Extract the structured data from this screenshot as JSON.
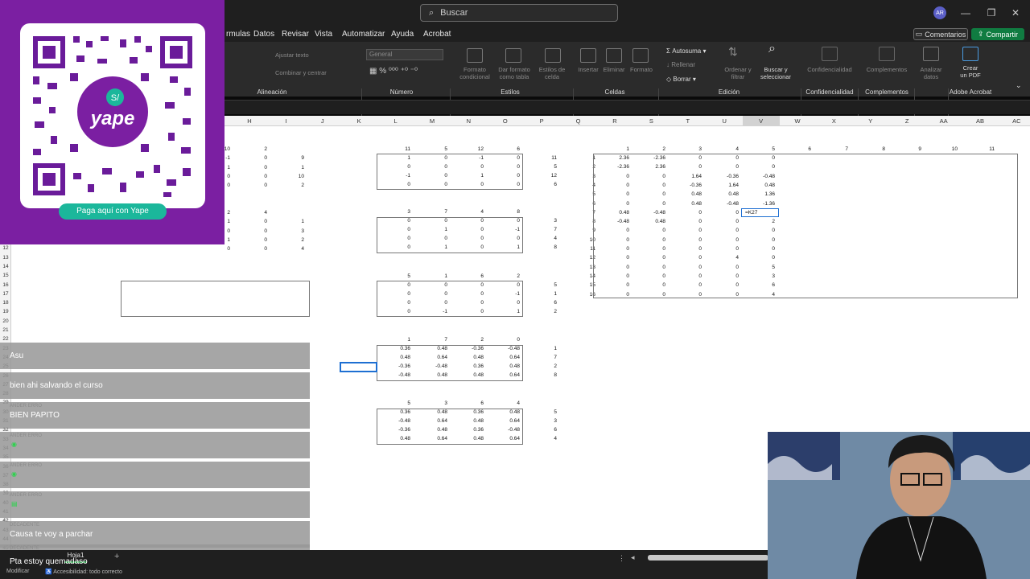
{
  "titlebar": {
    "search_placeholder": "Buscar",
    "avatar_initials": "AR",
    "minimize": "—",
    "maximize": "❐",
    "close": "✕"
  },
  "menu": [
    "rmulas",
    "Datos",
    "Revisar",
    "Vista",
    "Automatizar",
    "Ayuda",
    "Acrobat"
  ],
  "buttons": {
    "comments": "Comentarios",
    "share": "Compartir"
  },
  "ribbon": {
    "ajustar_texto": "Ajustar texto",
    "combinar": "Combinar y centrar",
    "number_format": "General",
    "formato_cond": "Formato\ncondicional",
    "dar_formato": "Dar formato\ncomo tabla",
    "estilos_celda": "Estilos de\ncelda",
    "insertar": "Insertar",
    "eliminar": "Eliminar",
    "formato": "Formato",
    "autosuma": "Autosuma",
    "rellenar": "Rellenar",
    "borrar": "Borrar",
    "ordenar": "Ordenar y\nfiltrar",
    "buscar_sel": "Buscar y\nseleccionar",
    "confidencialidad": "Confidencialidad",
    "complementos": "Complementos",
    "analizar": "Analizar\ndatos",
    "crear_pdf": "Crear\nun PDF",
    "groups": {
      "alineacion": "Alineación",
      "numero": "Número",
      "estilos": "Estilos",
      "celdas": "Celdas",
      "edicion": "Edición",
      "confidencialidad": "Confidencialidad",
      "complementos": "Complementos",
      "acrobat": "Adobe Acrobat"
    }
  },
  "columns": [
    "H",
    "I",
    "J",
    "K",
    "L",
    "M",
    "N",
    "O",
    "P",
    "Q",
    "R",
    "S",
    "T",
    "U",
    "V",
    "W",
    "X",
    "Y",
    "Z",
    "AA",
    "AB",
    "AC"
  ],
  "selected_column": "V",
  "formula_text": "=K27",
  "sheet_tab": "Hoja1",
  "status": {
    "mode": "Modificar",
    "accessibility": "Accesibilidad: todo correcto"
  },
  "qr": {
    "button_text": "Paga aquí con Yape",
    "brand": "yape"
  },
  "chat": [
    {
      "name": "",
      "message": "Asu"
    },
    {
      "name": "",
      "message": "bien ahi salvando el curso"
    },
    {
      "name": "ANDER ERRO",
      "message": "BIEN PAPITO"
    },
    {
      "name": "ANDER ERRO",
      "message": "",
      "emote": "◉"
    },
    {
      "name": "ANDER ERRO",
      "message": "",
      "emote": "◉"
    },
    {
      "name": "ANDER ERRO",
      "message": "",
      "emote": "▤"
    },
    {
      "name": "DECADENTE",
      "message": "Causa te voy a parchar"
    },
    {
      "name": "DECADENTE",
      "message": "Pta estoy quemadaso"
    }
  ],
  "cells": {
    "block1_header": [
      "11",
      "5",
      "12",
      "6"
    ],
    "block1": [
      [
        "1",
        "0",
        "-1",
        "0"
      ],
      [
        "0",
        "0",
        "0",
        "0"
      ],
      [
        "-1",
        "0",
        "1",
        "0"
      ],
      [
        "0",
        "0",
        "0",
        "0"
      ]
    ],
    "block1_side": [
      "11",
      "5",
      "12",
      "6"
    ],
    "block2_header": [
      "3",
      "7",
      "4",
      "8"
    ],
    "block2": [
      [
        "0",
        "0",
        "0",
        "0"
      ],
      [
        "0",
        "1",
        "0",
        "-1"
      ],
      [
        "0",
        "0",
        "0",
        "0"
      ],
      [
        "0",
        "1",
        "0",
        "1"
      ]
    ],
    "block2_side": [
      "3",
      "7",
      "4",
      "8"
    ],
    "block3_header": [
      "5",
      "1",
      "6",
      "2"
    ],
    "block3": [
      [
        "0",
        "0",
        "0",
        "0"
      ],
      [
        "0",
        "0",
        "0",
        "-1"
      ],
      [
        "0",
        "0",
        "0",
        "0"
      ],
      [
        "0",
        "-1",
        "0",
        "1"
      ]
    ],
    "block3_side": [
      "5",
      "1",
      "6",
      "2"
    ],
    "block4_header": [
      "1",
      "7",
      "2",
      "0"
    ],
    "block4": [
      [
        "0.36",
        "0.48",
        "-0.36",
        "-0.48"
      ],
      [
        "0.48",
        "0.64",
        "0.48",
        "0.64"
      ],
      [
        "-0.36",
        "-0.48",
        "0.36",
        "0.48"
      ],
      [
        "-0.48",
        "0.48",
        "0.48",
        "0.64"
      ]
    ],
    "block4_side": [
      "1",
      "7",
      "2",
      "8"
    ],
    "block5_header": [
      "5",
      "3",
      "6",
      "4"
    ],
    "block5": [
      [
        "0.36",
        "0.48",
        "0.36",
        "0.48"
      ],
      [
        "-0.48",
        "0.64",
        "0.48",
        "0.64"
      ],
      [
        "-0.36",
        "0.48",
        "0.36",
        "-0.48"
      ],
      [
        "0.48",
        "0.64",
        "0.48",
        "0.64"
      ]
    ],
    "block5_side": [
      "5",
      "3",
      "6",
      "4"
    ],
    "big_header": [
      "1",
      "2",
      "3",
      "4",
      "5",
      "6",
      "7",
      "8",
      "9",
      "10",
      "11"
    ],
    "big_rows": [
      [
        "1",
        "2.36",
        "-2.36",
        "0",
        "0",
        "0"
      ],
      [
        "2",
        "-2.36",
        "2.36",
        "0",
        "0",
        "0"
      ],
      [
        "3",
        "0",
        "0",
        "1.64",
        "-0.36",
        "-0.48"
      ],
      [
        "4",
        "0",
        "0",
        "-0.36",
        "1.64",
        "0.48"
      ],
      [
        "5",
        "0",
        "0",
        "0.48",
        "0.48",
        "1.36"
      ],
      [
        "6",
        "0",
        "0",
        "0.48",
        "-0.48",
        "-1.36"
      ],
      [
        "7",
        "0.48",
        "-0.48",
        "0",
        "0",
        ""
      ],
      [
        "8",
        "-0.48",
        "0.48",
        "0",
        "0",
        "2"
      ],
      [
        "9",
        "0",
        "0",
        "0",
        "0",
        "0"
      ],
      [
        "10",
        "0",
        "0",
        "0",
        "0",
        "0"
      ],
      [
        "11",
        "0",
        "0",
        "0",
        "0",
        "0"
      ],
      [
        "12",
        "0",
        "0",
        "0",
        "4",
        "0"
      ],
      [
        "13",
        "0",
        "0",
        "0",
        "0",
        "5"
      ],
      [
        "14",
        "0",
        "0",
        "0",
        "0",
        "3"
      ],
      [
        "15",
        "0",
        "0",
        "0",
        "0",
        "6"
      ],
      [
        "16",
        "0",
        "0",
        "0",
        "0",
        "4"
      ]
    ],
    "left_top": [
      [
        "10",
        "2",
        ""
      ],
      [
        "-1",
        "0",
        "9"
      ],
      [
        "1",
        "0",
        "1"
      ],
      [
        "0",
        "0",
        "10"
      ],
      [
        "0",
        "0",
        "2"
      ]
    ],
    "left_mid": [
      [
        "2",
        "4",
        ""
      ],
      [
        "1",
        "0",
        "1"
      ],
      [
        "0",
        "0",
        "3"
      ],
      [
        "1",
        "0",
        "2"
      ],
      [
        "0",
        "0",
        "4"
      ]
    ]
  },
  "colors": {
    "accent_green": "#107c41",
    "yape_purple": "#7b1fa2",
    "yape_teal": "#1bb79b",
    "selection_blue": "#1e6fd2"
  }
}
